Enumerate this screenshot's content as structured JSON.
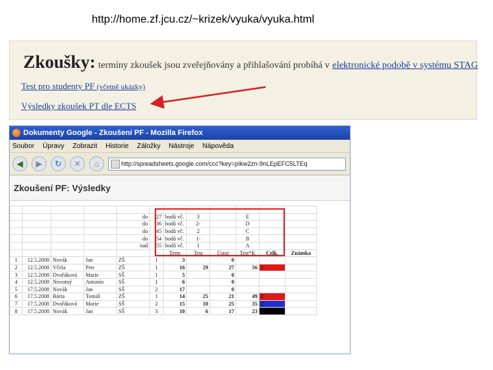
{
  "caption": "http://home.zf.jcu.cz/~krizek/vyuka/vyuka.html",
  "web": {
    "title": "Zkoušky:",
    "desc": "termíny zkoušek jsou zveřejňovány a přihlašování probíhá v",
    "desc_link": "elektronické podobě v systému STAG",
    "link1": "Test pro studenty PF",
    "link1_small": "(včetně ukázky)",
    "link2": "Výsledky zkoušek PT dle ECTS"
  },
  "firefox": {
    "title": "Dokumenty Google - Zkoušení PF - Mozilla Firefox",
    "menu": [
      "Soubor",
      "Úpravy",
      "Zobrazit",
      "Historie",
      "Záložky",
      "Nástroje",
      "Nápověda"
    ],
    "url": "http://spreadsheets.google.com/ccc?key=pIkw2zn-9nLEpEFC5LTEq",
    "doc_title": "Zkoušení PF: Výsledky"
  },
  "ects_scale": [
    {
      "op": "do",
      "min": "27",
      "unit": "bodů vč.",
      "grade_num": "3",
      "letter": "E"
    },
    {
      "op": "do",
      "min": "36",
      "unit": "bodů vč.",
      "grade_num": "2-",
      "letter": "D"
    },
    {
      "op": "do",
      "min": "45",
      "unit": "bodů vč.",
      "grade_num": "2",
      "letter": "C"
    },
    {
      "op": "do",
      "min": "54",
      "unit": "bodů vč.",
      "grade_num": "1-",
      "letter": "B"
    },
    {
      "op": "nad",
      "min": "55",
      "unit": "bodů vč.",
      "grade_num": "1",
      "letter": "A"
    }
  ],
  "table": {
    "headers": [
      "Term",
      "Test",
      "Ústní",
      "Test*K",
      "Celk.",
      "Známka"
    ],
    "rows": [
      {
        "n": "1",
        "date": "12.5.2008",
        "name": "Novák",
        "first": "Jan",
        "school": "ZŠ",
        "term": "1",
        "test": "3",
        "oral": "",
        "testk": "0",
        "total": "",
        "grade": "",
        "gclass": ""
      },
      {
        "n": "2",
        "date": "12.5.2008",
        "name": "Včela",
        "first": "Petr",
        "school": "ZŠ",
        "term": "1",
        "test": "16",
        "oral": "29",
        "testk": "27",
        "total": "56",
        "grade": "1",
        "gclass": "grade-red"
      },
      {
        "n": "3",
        "date": "12.5.2008",
        "name": "Dvořáková",
        "first": "Marie",
        "school": "SŠ",
        "term": "1",
        "test": "5",
        "oral": "",
        "testk": "0",
        "total": "",
        "grade": "",
        "gclass": ""
      },
      {
        "n": "4",
        "date": "12.5.2008",
        "name": "Novotný",
        "first": "Antonín",
        "school": "SŠ",
        "term": "1",
        "test": "6",
        "oral": "",
        "testk": "0",
        "total": "",
        "grade": "",
        "gclass": ""
      },
      {
        "n": "5",
        "date": "17.5.2008",
        "name": "Novák",
        "first": "Jan",
        "school": "SŠ",
        "term": "2",
        "test": "17",
        "oral": "",
        "testk": "0",
        "total": "",
        "grade": "",
        "gclass": ""
      },
      {
        "n": "6",
        "date": "17.5.2008",
        "name": "Bárta",
        "first": "Tomáš",
        "school": "ZŠ",
        "term": "1",
        "test": "14",
        "oral": "25",
        "testk": "21",
        "total": "49",
        "grade": "1",
        "gclass": "grade-red"
      },
      {
        "n": "7",
        "date": "17.5.2008",
        "name": "Dvořáková",
        "first": "Marie",
        "school": "SŠ",
        "term": "2",
        "test": "15",
        "oral": "10",
        "testk": "25",
        "total": "35",
        "grade": "2-",
        "gclass": "grade-blue"
      },
      {
        "n": "8",
        "date": "17.5.2008",
        "name": "Novák",
        "first": "Jan",
        "school": "SŠ",
        "term": "3",
        "test": "10",
        "oral": "6",
        "testk": "17",
        "total": "23",
        "grade": "3",
        "gclass": "grade-black"
      }
    ]
  },
  "colors": {
    "accent_red": "#d22222",
    "link_blue": "#1a3d99",
    "titlebar": "#2f5fd0"
  }
}
